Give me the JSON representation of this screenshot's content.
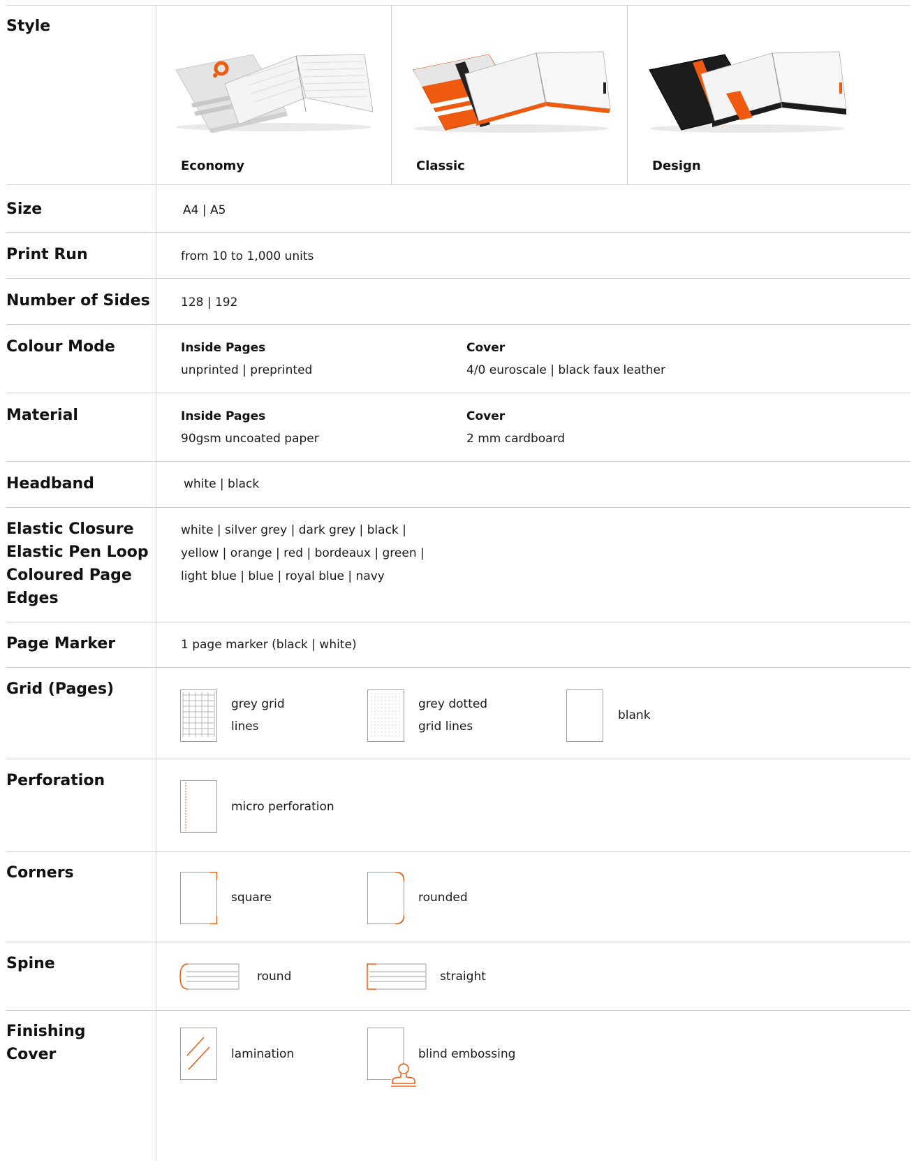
{
  "rows": {
    "style": {
      "label": "Style",
      "options": [
        {
          "name": "Economy",
          "cover_color": "#e6e6e6",
          "accent": "#ee5a0f"
        },
        {
          "name": "Classic",
          "cover_color": "#ee5a0f",
          "accent": "#222222"
        },
        {
          "name": "Design",
          "cover_color": "#1c1c1c",
          "accent": "#ee5a0f"
        }
      ]
    },
    "size": {
      "label": "Size",
      "value": "A4 | A5"
    },
    "print_run": {
      "label": "Print Run",
      "value": "from 10 to 1,000 units"
    },
    "number_of_sides": {
      "label": "Number of Sides",
      "value": "128 | 192"
    },
    "colour_mode": {
      "label": "Colour Mode",
      "inside_title": "Inside Pages",
      "inside_value": "unprinted | preprinted",
      "cover_title": "Cover",
      "cover_value": "4/0 euroscale | black faux leather"
    },
    "material": {
      "label": "Material",
      "inside_title": "Inside Pages",
      "inside_value": "90gsm uncoated paper",
      "cover_title": "Cover",
      "cover_value": "2 mm cardboard"
    },
    "headband": {
      "label": "Headband",
      "value": "white | black"
    },
    "elastic": {
      "label_lines": [
        "Elastic Closure",
        "Elastic Pen Loop",
        "Coloured Page",
        "Edges"
      ],
      "value_lines": [
        "white | silver grey | dark grey | black |",
        "yellow | orange | red | bordeaux | green |",
        "light blue | blue | royal blue | navy"
      ]
    },
    "page_marker": {
      "label": "Page Marker",
      "value": "1 page marker (black | white)"
    },
    "grid": {
      "label": "Grid (Pages)",
      "options": [
        {
          "line1": "grey grid",
          "line2": "lines",
          "icon": "grid-lines-icon"
        },
        {
          "line1": "grey dotted",
          "line2": "grid lines",
          "icon": "dotted-grid-icon"
        },
        {
          "line1": "blank",
          "line2": "",
          "icon": "blank-page-icon"
        }
      ]
    },
    "perforation": {
      "label": "Perforation",
      "value": "micro perforation",
      "icon": "micro-perforation-icon"
    },
    "corners": {
      "label": "Corners",
      "options": [
        {
          "value": "square",
          "icon": "square-corner-icon"
        },
        {
          "value": "rounded",
          "icon": "rounded-corner-icon"
        }
      ]
    },
    "spine": {
      "label": "Spine",
      "options": [
        {
          "value": "round",
          "icon": "round-spine-icon"
        },
        {
          "value": "straight",
          "icon": "straight-spine-icon"
        }
      ]
    },
    "finishing": {
      "label_lines": [
        "Finishing",
        "Cover"
      ],
      "options": [
        {
          "value": "lamination",
          "icon": "lamination-icon"
        },
        {
          "value": "blind embossing",
          "icon": "stamp-icon"
        }
      ]
    }
  },
  "colors": {
    "accent": "#ee5a0f",
    "divider": "#cfcfcf",
    "icon_stroke": "#9aa0a6"
  }
}
